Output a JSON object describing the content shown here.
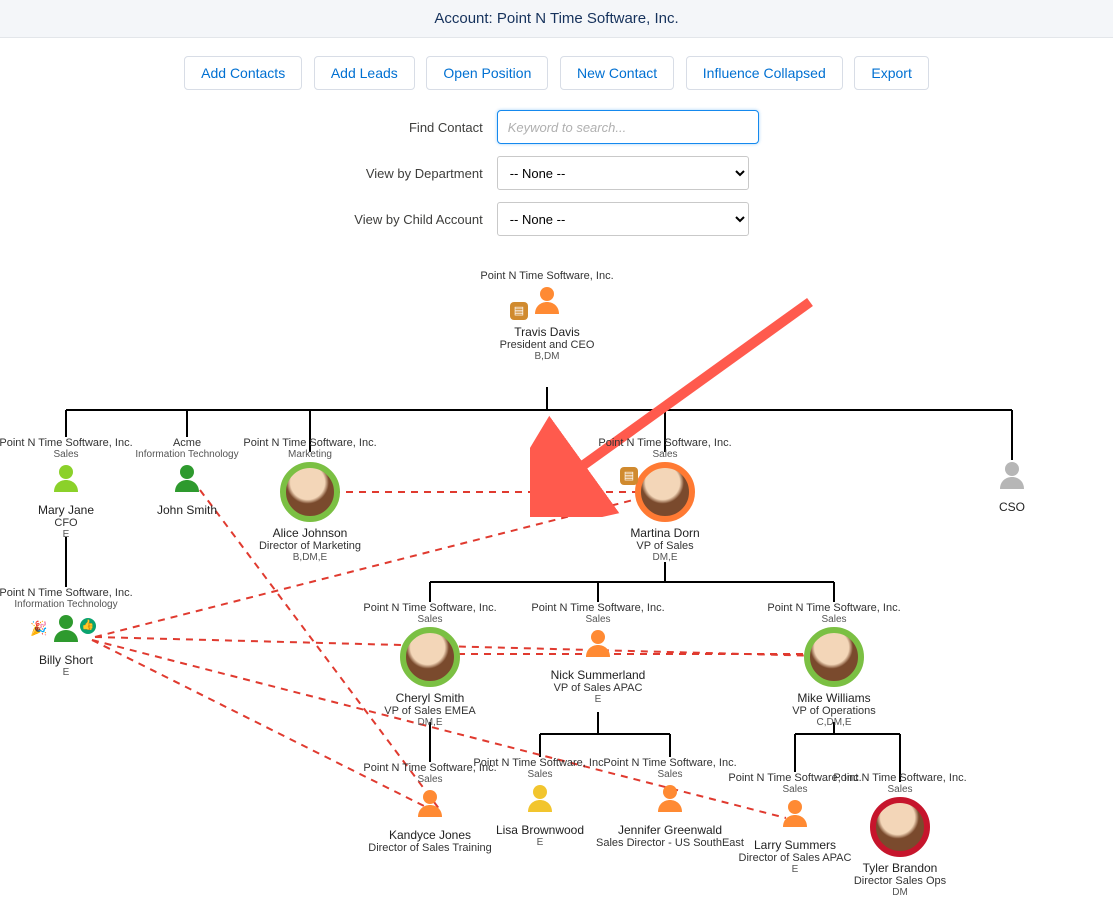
{
  "header": {
    "title": "Account: Point N Time Software, Inc."
  },
  "toolbar": {
    "add_contacts": "Add Contacts",
    "add_leads": "Add Leads",
    "open_position": "Open Position",
    "new_contact": "New Contact",
    "influence": "Influence Collapsed",
    "export": "Export"
  },
  "filters": {
    "find_label": "Find Contact",
    "find_placeholder": "Keyword to search...",
    "dept_label": "View by Department",
    "dept_value": "-- None --",
    "child_label": "View by Child Account",
    "child_value": "-- None --"
  },
  "nodes": {
    "root": {
      "company": "Point N Time Software, Inc.",
      "dept": "",
      "name": "Travis Davis",
      "title": "President and CEO",
      "tags": "B,DM"
    },
    "mary": {
      "company": "Point N Time Software, Inc.",
      "dept": "Sales",
      "name": "Mary Jane",
      "title": "CFO",
      "tags": "E"
    },
    "john": {
      "company": "Acme",
      "dept": "Information Technology",
      "name": "John Smith",
      "title": "",
      "tags": ""
    },
    "alice": {
      "company": "Point N Time Software, Inc.",
      "dept": "Marketing",
      "name": "Alice Johnson",
      "title": "Director of Marketing",
      "tags": "B,DM,E"
    },
    "martina": {
      "company": "Point N Time Software, Inc.",
      "dept": "Sales",
      "name": "Martina Dorn",
      "title": "VP of Sales",
      "tags": "DM,E"
    },
    "cso": {
      "company": "",
      "dept": "",
      "name": "CSO",
      "title": "",
      "tags": ""
    },
    "billy": {
      "company": "Point N Time Software, Inc.",
      "dept": "Information Technology",
      "name": "Billy Short",
      "title": "",
      "tags": "E"
    },
    "cheryl": {
      "company": "Point N Time Software, Inc.",
      "dept": "Sales",
      "name": "Cheryl Smith",
      "title": "VP of Sales EMEA",
      "tags": "DM,E"
    },
    "nick": {
      "company": "Point N Time Software, Inc.",
      "dept": "Sales",
      "name": "Nick Summerland",
      "title": "VP of Sales APAC",
      "tags": "E"
    },
    "mike": {
      "company": "Point N Time Software, Inc.",
      "dept": "Sales",
      "name": "Mike Williams",
      "title": "VP of Operations",
      "tags": "C,DM,E"
    },
    "kandyce": {
      "company": "Point N Time Software, Inc.",
      "dept": "Sales",
      "name": "Kandyce Jones",
      "title": "Director of Sales Training",
      "tags": ""
    },
    "lisa": {
      "company": "Point N Time Software, Inc.",
      "dept": "Sales",
      "name": "Lisa Brownwood",
      "title": "",
      "tags": "E"
    },
    "jennifer": {
      "company": "Point N Time Software, Inc.",
      "dept": "Sales",
      "name": "Jennifer Greenwald",
      "title": "Sales Director - US SouthEast",
      "tags": ""
    },
    "larry": {
      "company": "Point N Time Software, Inc.",
      "dept": "Sales",
      "name": "Larry Summers",
      "title": "Director of Sales APAC",
      "tags": "E"
    },
    "tyler": {
      "company": "Point N Time Software, Inc.",
      "dept": "Sales",
      "name": "Tyler Brandon",
      "title": "Director Sales Ops",
      "tags": "DM"
    }
  }
}
